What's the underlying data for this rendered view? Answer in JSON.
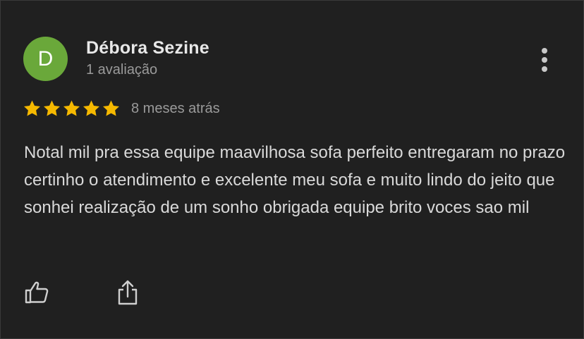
{
  "reviewer": {
    "avatar_letter": "D",
    "avatar_color": "#6aa83a",
    "name": "Débora Sezine",
    "review_count": "1 avaliação"
  },
  "rating": {
    "stars": 5,
    "max": 5,
    "star_color": "#f6b900"
  },
  "time_ago": "8 meses atrás",
  "review_text": "Notal mil pra essa equipe maavilhosa sofa perfeito entregaram no prazo certinho o atendimento e excelente meu sofa e muito lindo do jeito que sonhei realização de um sonho obrigada equipe brito voces sao mil",
  "actions": {
    "like_icon": "thumbs-up-icon",
    "share_icon": "share-icon",
    "more_icon": "more-vert-icon"
  }
}
